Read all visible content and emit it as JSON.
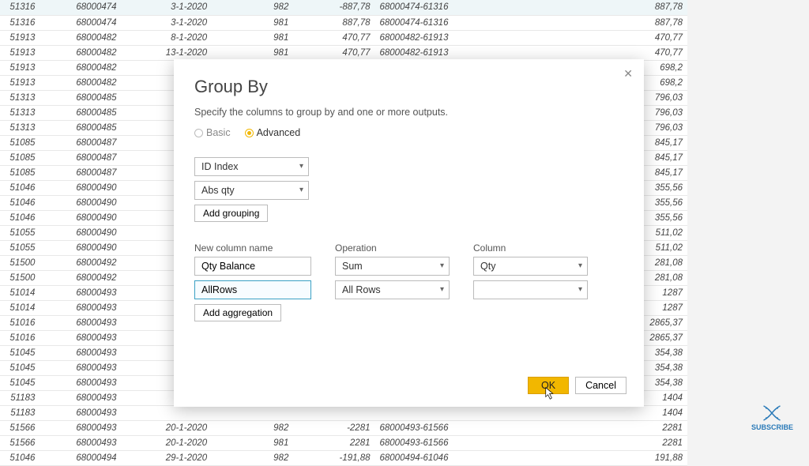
{
  "background_table": {
    "rows": [
      {
        "c1": "51316",
        "c2": "68000474",
        "c3": "3-1-2020",
        "c4": "982",
        "c5": "-887,78",
        "c6": "68000474-61316",
        "c8": "887,78",
        "sel": true
      },
      {
        "c1": "51316",
        "c2": "68000474",
        "c3": "3-1-2020",
        "c4": "981",
        "c5": "887,78",
        "c6": "68000474-61316",
        "c8": "887,78"
      },
      {
        "c1": "51913",
        "c2": "68000482",
        "c3": "8-1-2020",
        "c4": "981",
        "c5": "470,77",
        "c6": "68000482-61913",
        "c8": "470,77"
      },
      {
        "c1": "51913",
        "c2": "68000482",
        "c3": "13-1-2020",
        "c4": "981",
        "c5": "470,77",
        "c6": "68000482-61913",
        "c8": "470,77"
      },
      {
        "c1": "51913",
        "c2": "68000482",
        "c8": "698,2"
      },
      {
        "c1": "51913",
        "c2": "68000482",
        "c8": "698,2"
      },
      {
        "c1": "51313",
        "c2": "68000485",
        "c8": "796,03"
      },
      {
        "c1": "51313",
        "c2": "68000485",
        "c8": "796,03"
      },
      {
        "c1": "51313",
        "c2": "68000485",
        "c8": "796,03"
      },
      {
        "c1": "51085",
        "c2": "68000487",
        "c8": "845,17"
      },
      {
        "c1": "51085",
        "c2": "68000487",
        "c8": "845,17"
      },
      {
        "c1": "51085",
        "c2": "68000487",
        "c8": "845,17"
      },
      {
        "c1": "51046",
        "c2": "68000490",
        "c8": "355,56"
      },
      {
        "c1": "51046",
        "c2": "68000490",
        "c8": "355,56"
      },
      {
        "c1": "51046",
        "c2": "68000490",
        "c8": "355,56"
      },
      {
        "c1": "51055",
        "c2": "68000490",
        "c8": "511,02"
      },
      {
        "c1": "51055",
        "c2": "68000490",
        "c8": "511,02"
      },
      {
        "c1": "51500",
        "c2": "68000492",
        "c8": "281,08"
      },
      {
        "c1": "51500",
        "c2": "68000492",
        "c8": "281,08"
      },
      {
        "c1": "51014",
        "c2": "68000493",
        "c8": "1287"
      },
      {
        "c1": "51014",
        "c2": "68000493",
        "c8": "1287"
      },
      {
        "c1": "51016",
        "c2": "68000493",
        "c8": "2865,37"
      },
      {
        "c1": "51016",
        "c2": "68000493",
        "c8": "2865,37"
      },
      {
        "c1": "51045",
        "c2": "68000493",
        "c8": "354,38"
      },
      {
        "c1": "51045",
        "c2": "68000493",
        "c8": "354,38"
      },
      {
        "c1": "51045",
        "c2": "68000493",
        "c8": "354,38"
      },
      {
        "c1": "51183",
        "c2": "68000493",
        "c8": "1404"
      },
      {
        "c1": "51183",
        "c2": "68000493",
        "c8": "1404"
      },
      {
        "c1": "51566",
        "c2": "68000493",
        "c3": "20-1-2020",
        "c4": "982",
        "c5": "-2281",
        "c6": "68000493-61566",
        "c8": "2281"
      },
      {
        "c1": "51566",
        "c2": "68000493",
        "c3": "20-1-2020",
        "c4": "981",
        "c5": "2281",
        "c6": "68000493-61566",
        "c8": "2281"
      },
      {
        "c1": "51046",
        "c2": "68000494",
        "c3": "29-1-2020",
        "c4": "982",
        "c5": "-191,88",
        "c6": "68000494-61046",
        "c8": "191,88"
      }
    ]
  },
  "dialog": {
    "title": "Group By",
    "subtitle": "Specify the columns to group by and one or more outputs.",
    "radio_basic": "Basic",
    "radio_advanced": "Advanced",
    "groupings": [
      "ID Index",
      "Abs qty"
    ],
    "add_grouping": "Add grouping",
    "labels": {
      "newcol": "New column name",
      "operation": "Operation",
      "column": "Column"
    },
    "agg_rows": [
      {
        "name": "Qty Balance",
        "op": "Sum",
        "col": "Qty"
      },
      {
        "name": "AllRows",
        "op": "All Rows",
        "col": ""
      }
    ],
    "add_aggregation": "Add aggregation",
    "ok": "OK",
    "cancel": "Cancel"
  },
  "subscribe": "SUBSCRIBE"
}
